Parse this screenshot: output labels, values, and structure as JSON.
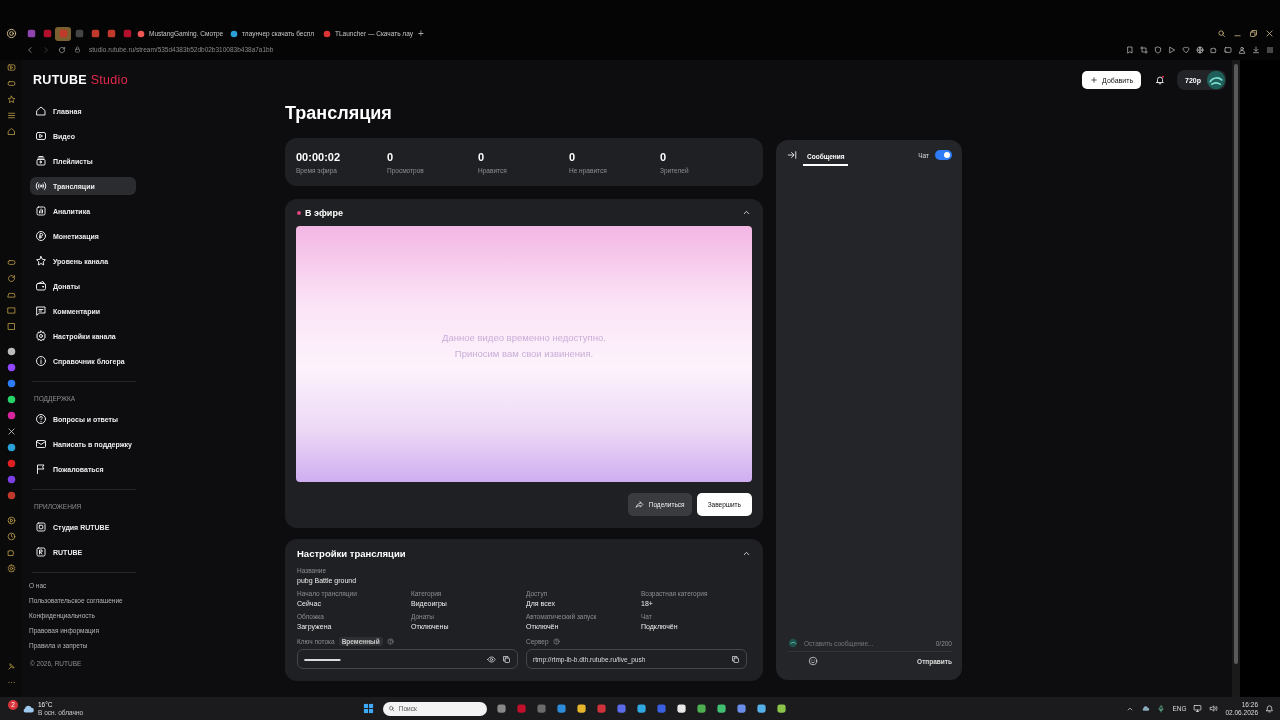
{
  "browser": {
    "tabs": [
      {
        "kind": "icon",
        "selected": false
      },
      {
        "kind": "icon",
        "selected": false
      },
      {
        "kind": "icon",
        "selected": true
      },
      {
        "kind": "icon",
        "selected": false
      },
      {
        "kind": "icon",
        "selected": false
      },
      {
        "kind": "icon",
        "selected": false
      },
      {
        "kind": "icon",
        "selected": false
      },
      {
        "kind": "text",
        "label": "MustangGaming. Смотре",
        "selected": false
      },
      {
        "kind": "text",
        "label": "тлаунчер скачать беспл",
        "selected": false
      },
      {
        "kind": "text",
        "label": "TLauncher — Скачать лау",
        "selected": false
      }
    ],
    "new_tab": "+",
    "url": "studio.rutube.ru/stream/535d4383b52db02b310083b438a7a1bb"
  },
  "header": {
    "logo_brand": "RUTUBE",
    "logo_product": "Studio",
    "add_button": "Добавить",
    "quality": "720p"
  },
  "sidebar": {
    "sections": [
      {
        "items": [
          {
            "label": "Главная",
            "selected": false
          },
          {
            "label": "Видео",
            "selected": false
          },
          {
            "label": "Плейлисты",
            "selected": false
          },
          {
            "label": "Трансляции",
            "selected": true
          },
          {
            "label": "Аналитика",
            "selected": false
          },
          {
            "label": "Монетизация",
            "selected": false
          },
          {
            "label": "Уровень канала",
            "selected": false
          },
          {
            "label": "Донаты",
            "selected": false
          },
          {
            "label": "Комментарии",
            "selected": false
          },
          {
            "label": "Настройки канала",
            "selected": false
          },
          {
            "label": "Справочник блогера",
            "selected": false
          }
        ]
      },
      {
        "heading": "ПОДДЕРЖКА",
        "items": [
          {
            "label": "Вопросы и ответы",
            "selected": false
          },
          {
            "label": "Написать в поддержку",
            "selected": false
          },
          {
            "label": "Пожаловаться",
            "selected": false
          }
        ]
      },
      {
        "heading": "ПРИЛОЖЕНИЯ",
        "items": [
          {
            "label": "Студия RUTUBE",
            "selected": false
          },
          {
            "label": "RUTUBE",
            "selected": false
          }
        ]
      }
    ],
    "footer_links": [
      "О нас",
      "Пользовательское соглашение",
      "Конфиденциальность",
      "Правовая информация",
      "Правила и запреты"
    ],
    "copyright": "© 2026, RUTUBE"
  },
  "page_title": "Трансляция",
  "stats": [
    {
      "value": "00:00:02",
      "label": "Время эфира"
    },
    {
      "value": "0",
      "label": "Просмотров"
    },
    {
      "value": "0",
      "label": "Нравится"
    },
    {
      "value": "0",
      "label": "Не нравится"
    },
    {
      "value": "0",
      "label": "Зрителей"
    }
  ],
  "live": {
    "status": "В эфире",
    "expanded": true,
    "preview_lines": [
      "Данное видео временно недоступно.",
      "Приносим вам свои извинения."
    ],
    "share_button": "Поделиться",
    "finish_button": "Завершить"
  },
  "settings": {
    "title": "Настройки трансляции",
    "expanded": true,
    "name_label": "Название",
    "name_value": "pubg Battle ground",
    "fields": [
      {
        "label": "Начало трансляции",
        "value": "Сейчас"
      },
      {
        "label": "Категория",
        "value": "Видеоигры"
      },
      {
        "label": "Доступ",
        "value": "Для всех"
      },
      {
        "label": "Возрастная категория",
        "value": "18+"
      },
      {
        "label": "Обложка",
        "value": "Загружена"
      },
      {
        "label": "Донаты",
        "value": "Отключены"
      },
      {
        "label": "Автоматический запуск",
        "value": "Отключён"
      },
      {
        "label": "Чат",
        "value": "Подключён"
      }
    ],
    "key_label": "Ключ потока",
    "key_badge": "Временный",
    "key_value": "••••••••••••••••••••••••••••••••••••••••••••••••••••",
    "server_label": "Сервер",
    "server_value": "rtmp://rtmp-lb-b.dth.rutube.ru/live_push"
  },
  "chat": {
    "tab": "Сообщения",
    "tab_selected": true,
    "toggle_label": "Чат",
    "on": true,
    "placeholder": "Оставить сообщение...",
    "counter": "0/200",
    "send": "Отправить"
  },
  "taskbar": {
    "temperature": "16°C",
    "weather": "В осн. облачно",
    "weather_badge": "2",
    "search_placeholder": "Поиск",
    "language": "ENG",
    "time": "16:26",
    "date": "02.06.2026"
  }
}
